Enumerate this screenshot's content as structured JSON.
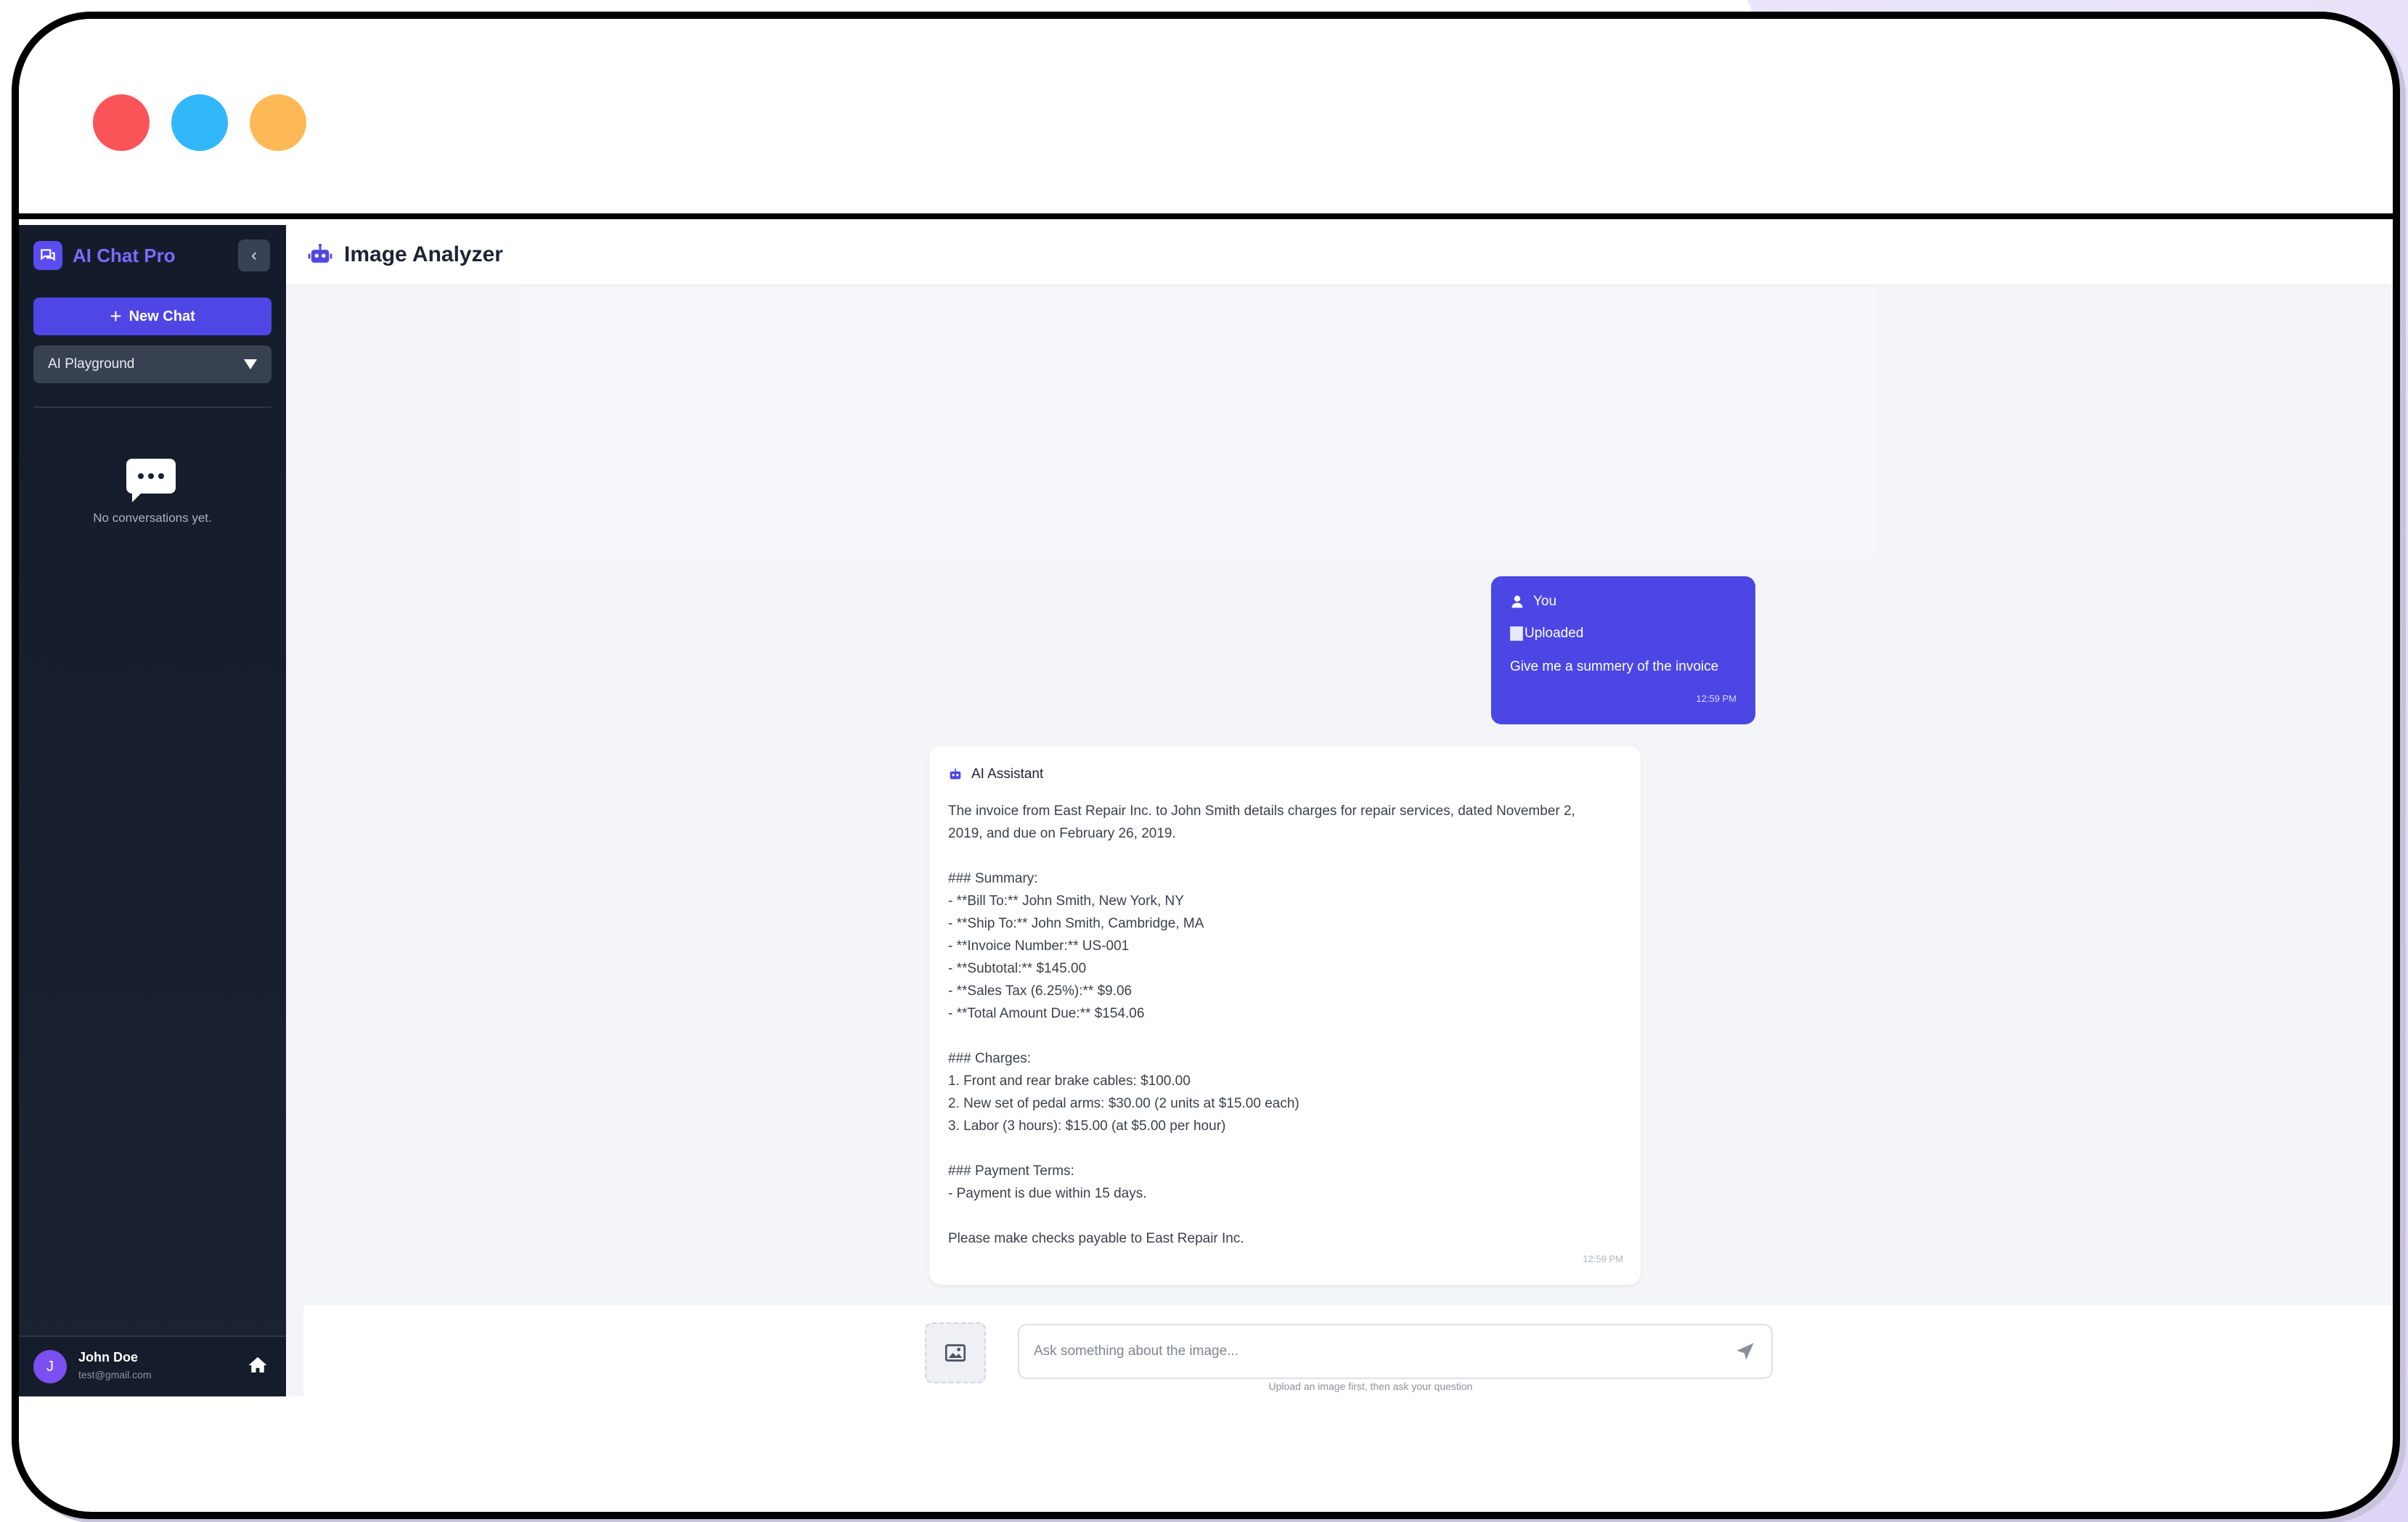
{
  "window": {
    "controls": [
      "close",
      "minimize",
      "maximize"
    ],
    "colors": {
      "close": "#fb5458",
      "minimize": "#33b7fb",
      "maximize": "#fdb956"
    }
  },
  "sidebar": {
    "brand": "AI Chat Pro",
    "brand_icon": "chat-bubbles-icon",
    "collapse_icon": "chevron-left-icon",
    "new_chat_label": "New Chat",
    "playground_label": "AI Playground",
    "empty_icon": "speech-bubble-dots-icon",
    "empty_text": "No conversations yet.",
    "user": {
      "initial": "J",
      "name": "John Doe",
      "email": "test@gmail.com"
    },
    "home_icon": "home-icon"
  },
  "header": {
    "icon": "robot-icon",
    "title": "Image Analyzer"
  },
  "messages": {
    "user": {
      "sender": "You",
      "image_alt": "Uploaded",
      "text": "Give me a summery of the invoice",
      "time": "12:59 PM"
    },
    "assistant": {
      "sender": "AI Assistant",
      "body": "The invoice from East Repair Inc. to John Smith details charges for repair services, dated November 2,\n2019, and due on February 26, 2019.\n\n### Summary:\n- **Bill To:** John Smith, New York, NY\n- **Ship To:** John Smith, Cambridge, MA\n- **Invoice Number:** US-001\n- **Subtotal:** $145.00\n- **Sales Tax (6.25%):** $9.06\n- **Total Amount Due:** $154.06\n\n### Charges:\n1. Front and rear brake cables: $100.00\n2. New set of pedal arms: $30.00 (2 units at $15.00 each)\n3. Labor (3 hours): $15.00 (at $5.00 per hour)\n\n### Payment Terms:\n- Payment is due within 15 days.\n\nPlease make checks payable to East Repair Inc.",
      "time": "12:59 PM"
    }
  },
  "composer": {
    "image_button_icon": "image-icon",
    "placeholder": "Ask something about the image...",
    "value": "",
    "send_icon": "send-icon",
    "hint": "Upload an image first, then ask your question"
  },
  "colors": {
    "accent": "#4f46e5",
    "sidebar_bg": "#141b2b",
    "user_bubble": "#4b46e4"
  }
}
